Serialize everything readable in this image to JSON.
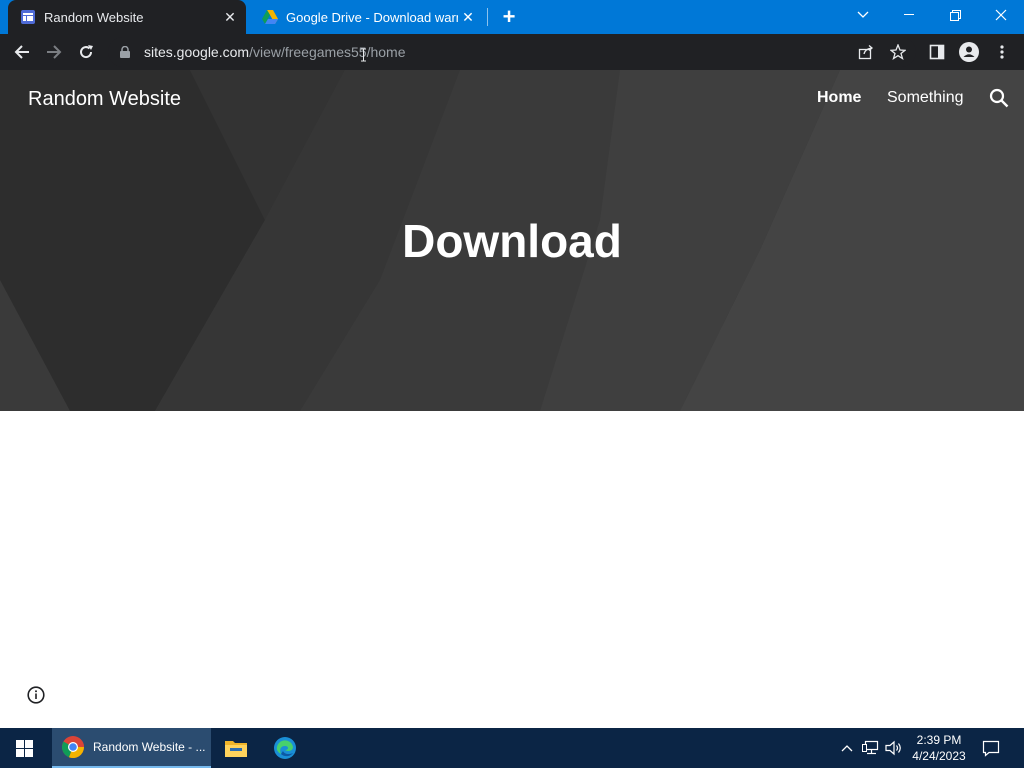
{
  "browser": {
    "tabs": [
      {
        "title": "Random Website",
        "active": true,
        "favicon": "sites-favicon"
      },
      {
        "title": "Google Drive - Download warning",
        "active": false,
        "favicon": "google-drive-icon"
      }
    ],
    "omnibox": {
      "host": "sites.google.com",
      "path": "/view/freegames55/home"
    }
  },
  "site": {
    "title": "Random Website",
    "nav": {
      "home": "Home",
      "something": "Something"
    },
    "hero_heading": "Download"
  },
  "taskbar": {
    "chrome_label": "Random Website - ...",
    "time": "2:39 PM",
    "date": "4/24/2023"
  },
  "colors": {
    "tabstrip": "#0078d7",
    "toolbar": "#202124",
    "hero": "#3a3a3a",
    "taskbar": "#0b2545"
  }
}
